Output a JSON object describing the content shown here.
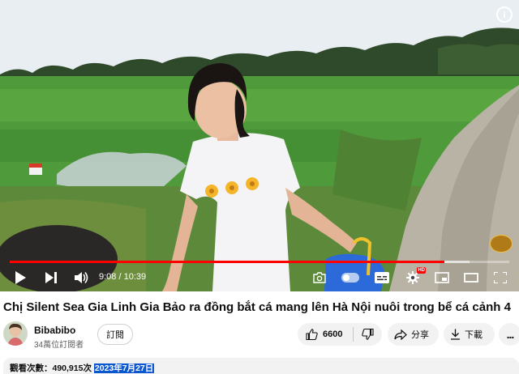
{
  "player": {
    "info_glyph": "i",
    "progress": {
      "played_fraction": 0.87,
      "buffered_fraction": 0.92
    },
    "time": {
      "current": "9:08",
      "separator": " / ",
      "duration": "10:39"
    },
    "hd_badge": "HD",
    "icons": {
      "play": "play-icon",
      "next": "next-icon",
      "volume": "volume-icon",
      "camera": "screenshot-icon",
      "autoplay": "autoplay-toggle",
      "subtitles": "subtitles-icon",
      "settings": "gear-icon",
      "miniplayer": "miniplayer-icon",
      "theater": "theater-icon",
      "fullscreen": "fullscreen-icon"
    }
  },
  "video": {
    "title": "Chị Silent Sea Gia Linh Gia Bảo ra đồng bắt cá mang lên Hà Nội nuôi trong bể cá cảnh 4"
  },
  "channel": {
    "name": "Bibabibo",
    "subscribers": "34萬位訂閱者",
    "subscribe_label": "訂閱"
  },
  "actions": {
    "like_count": "6600",
    "share_label": "分享",
    "download_label": "下載",
    "more_label": "..."
  },
  "description": {
    "views": "觀看次數：490,915次",
    "date": "2023年7月27日"
  },
  "colors": {
    "accent_red": "#ff0000",
    "pill_bg": "#f2f2f2",
    "highlight": "#0b57d0"
  }
}
